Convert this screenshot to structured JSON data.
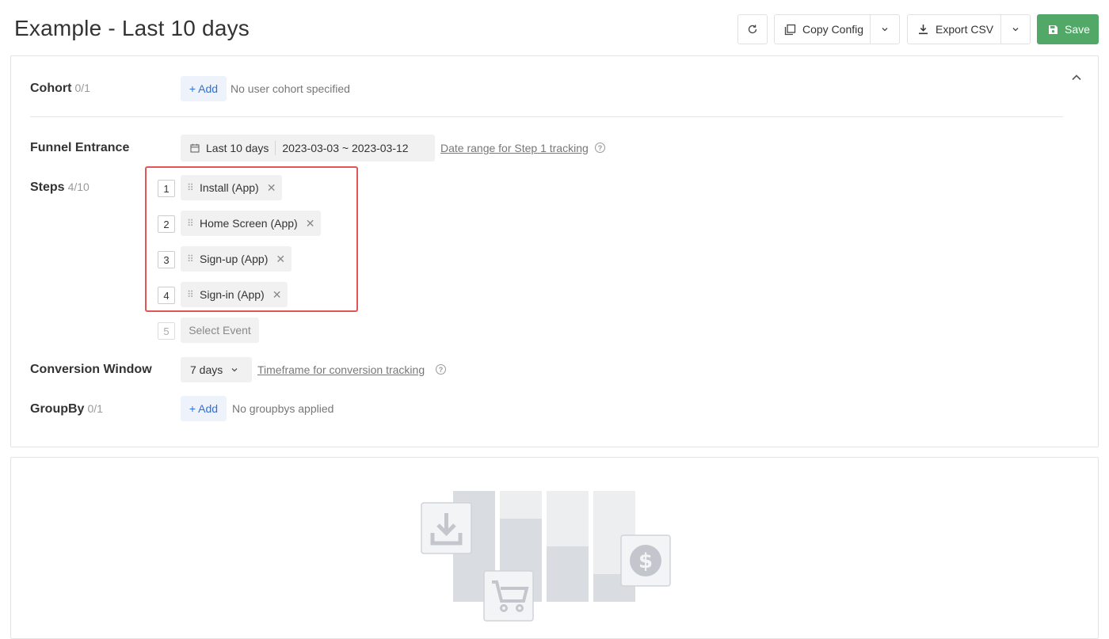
{
  "header": {
    "title": "Example - Last 10 days",
    "copy_config_label": "Copy Config",
    "export_csv_label": "Export CSV",
    "save_label": "Save"
  },
  "cohort": {
    "label": "Cohort",
    "count": "0/1",
    "add_label": "+ Add",
    "empty_text": "No user cohort specified"
  },
  "funnel_entrance": {
    "label": "Funnel Entrance",
    "preset": "Last 10 days",
    "range": "2023-03-03 ~ 2023-03-12",
    "help_link": "Date range for Step 1 tracking"
  },
  "steps": {
    "label": "Steps",
    "count": "4/10",
    "items": [
      {
        "number": "1",
        "name": "Install (App)"
      },
      {
        "number": "2",
        "name": "Home Screen (App)"
      },
      {
        "number": "3",
        "name": "Sign-up (App)"
      },
      {
        "number": "4",
        "name": "Sign-in (App)"
      }
    ],
    "next_number": "5",
    "select_placeholder": "Select Event"
  },
  "conversion_window": {
    "label": "Conversion Window",
    "value": "7 days",
    "help_link": "Timeframe for conversion tracking"
  },
  "groupby": {
    "label": "GroupBy",
    "count": "0/1",
    "add_label": "+ Add",
    "empty_text": "No groupbys applied"
  },
  "colors": {
    "save_green": "#52a967",
    "link_blue": "#2f6fd6",
    "highlight_red": "#e05656"
  },
  "icons": [
    "refresh-icon",
    "copy-icon",
    "chevron-down-icon",
    "download-icon",
    "save-icon",
    "chevron-up-icon",
    "calendar-icon",
    "help-icon",
    "drag-handle-icon",
    "close-icon",
    "empty-funnel-illustration"
  ]
}
